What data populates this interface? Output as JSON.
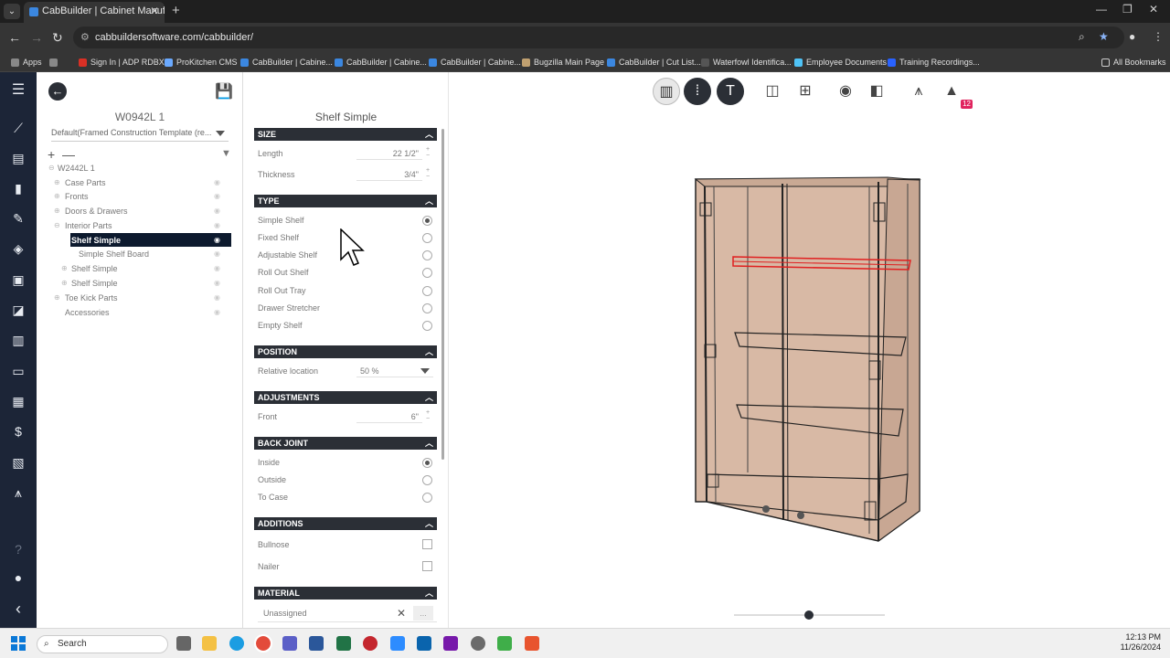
{
  "browser": {
    "tab_title": "CabBuilder | Cabinet Manufactu",
    "url": "cabbuildersoftware.com/cabbuilder/",
    "bookmarks": [
      {
        "label": "Apps",
        "color": "#888888"
      },
      {
        "label": "",
        "color": "#888888"
      },
      {
        "label": "Sign In | ADP RDBX",
        "color": "#d93025"
      },
      {
        "label": "ProKitchen CMS",
        "color": "#6aa9ff"
      },
      {
        "label": "CabBuilder | Cabine...",
        "color": "#3b87e0"
      },
      {
        "label": "CabBuilder | Cabine...",
        "color": "#3b87e0"
      },
      {
        "label": "CabBuilder | Cabine...",
        "color": "#3b87e0"
      },
      {
        "label": "Bugzilla Main Page",
        "color": "#c0a070"
      },
      {
        "label": "CabBuilder | Cut List...",
        "color": "#3b87e0"
      },
      {
        "label": "Waterfowl Identifica...",
        "color": "#555555"
      },
      {
        "label": "Employee Documents",
        "color": "#4fc3f7"
      },
      {
        "label": "Training Recordings...",
        "color": "#2962ff"
      }
    ],
    "all_bookmarks": "All Bookmarks"
  },
  "tree": {
    "cabinet_name": "W0942L 1",
    "template": "Default(Framed Construction Template (re...",
    "items": [
      {
        "label": "W2442L 1",
        "indent": 0
      },
      {
        "label": "Case Parts",
        "indent": 1
      },
      {
        "label": "Fronts",
        "indent": 1
      },
      {
        "label": "Doors & Drawers",
        "indent": 1
      },
      {
        "label": "Interior Parts",
        "indent": 1
      },
      {
        "label": "Shelf Simple",
        "indent": 2,
        "selected": true
      },
      {
        "label": "Simple Shelf Board",
        "indent": 3
      },
      {
        "label": "Shelf Simple",
        "indent": 2
      },
      {
        "label": "Shelf Simple",
        "indent": 2
      },
      {
        "label": "Toe Kick Parts",
        "indent": 1
      },
      {
        "label": "Accessories",
        "indent": 1
      }
    ]
  },
  "props": {
    "title": "Shelf Simple",
    "size": {
      "header": "SIZE",
      "length_label": "Length",
      "length_value": "22 1/2\"",
      "thickness_label": "Thickness",
      "thickness_value": "3/4\""
    },
    "type": {
      "header": "TYPE",
      "options": [
        "Simple Shelf",
        "Fixed Shelf",
        "Adjustable Shelf",
        "Roll Out Shelf",
        "Roll Out Tray",
        "Drawer Stretcher",
        "Empty Shelf"
      ],
      "selected": "Simple Shelf"
    },
    "position": {
      "header": "POSITION",
      "relative_label": "Relative location",
      "relative_value": "50 %"
    },
    "adjustments": {
      "header": "ADJUSTMENTS",
      "front_label": "Front",
      "front_value": "6\""
    },
    "back_joint": {
      "header": "BACK JOINT",
      "options": [
        "Inside",
        "Outside",
        "To Case"
      ],
      "selected": "Inside"
    },
    "additions": {
      "header": "ADDITIONS",
      "options": [
        "Bullnose",
        "Nailer"
      ]
    },
    "material": {
      "header": "MATERIAL",
      "value": "Unassigned",
      "more": "..."
    }
  },
  "viewer": {
    "badge_count": "12",
    "slider_value": 0.5,
    "highlight_color": "#e02020"
  },
  "taskbar": {
    "search_label": "Search",
    "time": "12:13 PM",
    "date": "11/26/2024"
  }
}
